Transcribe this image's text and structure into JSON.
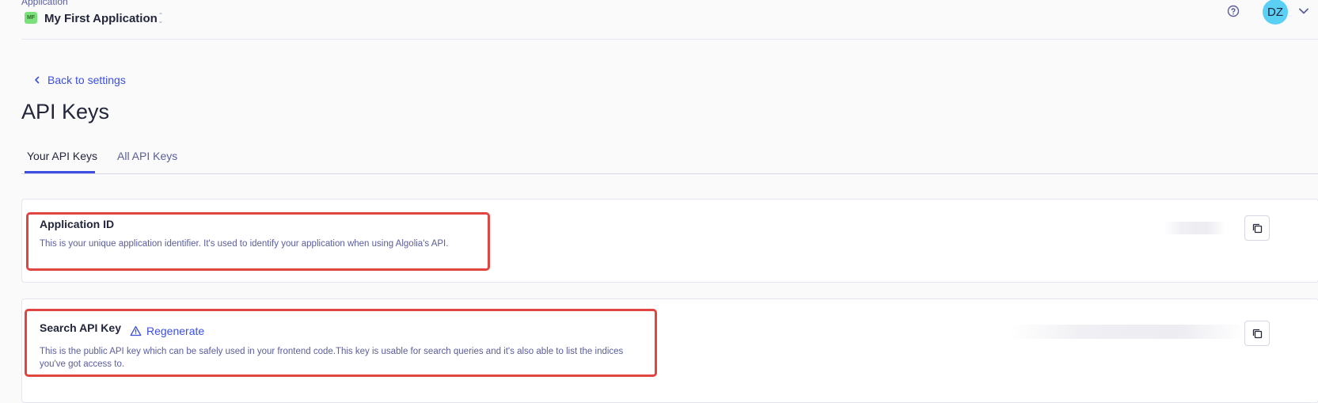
{
  "header": {
    "caption": "Application",
    "app_badge": "MF",
    "app_name": "My First Application",
    "avatar_initials": "DZ"
  },
  "nav": {
    "back_label": "Back to settings"
  },
  "page": {
    "title": "API Keys"
  },
  "tabs": [
    {
      "label": "Your API Keys",
      "active": true
    },
    {
      "label": "All API Keys",
      "active": false
    }
  ],
  "cards": {
    "application_id": {
      "title": "Application ID",
      "description": "This is your unique application identifier. It's used to identify your application when using Algolia's API."
    },
    "search_key": {
      "title": "Search API Key",
      "regenerate_label": "Regenerate",
      "description_line1": "This is the public API key which can be safely used in your frontend code.This key is usable for search queries and it's also able to list the indices",
      "description_line2": "you've got access to."
    }
  },
  "colors": {
    "accent": "#3c4fe0",
    "highlight": "#e0453f",
    "avatar": "#5ad0f5",
    "app_badge": "#7ae07a"
  },
  "icons": [
    "unfold-icon",
    "help-circle-icon",
    "chevron-down-icon",
    "chevron-left-icon",
    "copy-icon",
    "warning-triangle-icon"
  ]
}
